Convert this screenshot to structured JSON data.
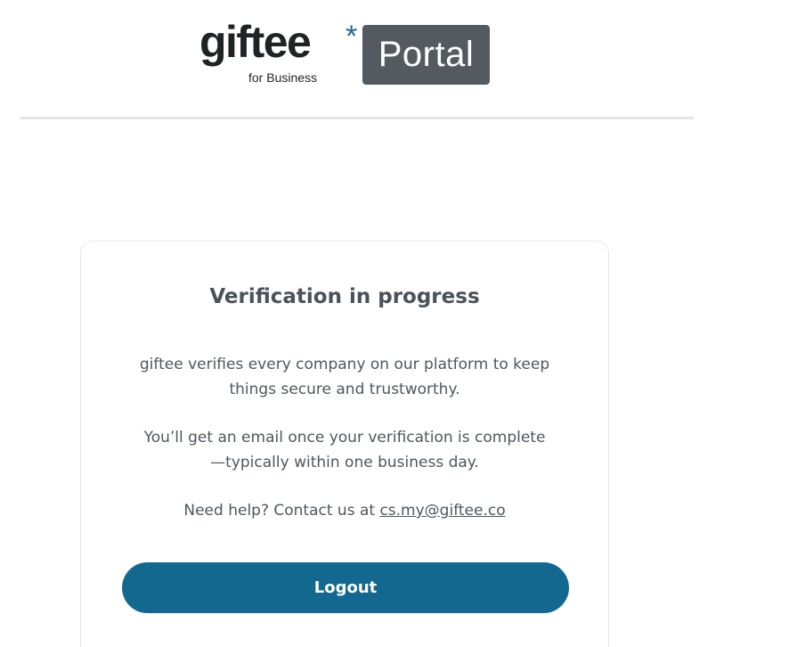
{
  "header": {
    "brand_name": "giftee",
    "brand_mark": "*",
    "brand_sub": "for Business",
    "portal_label": "Portal"
  },
  "card": {
    "title": "Verification in progress",
    "para1_line1": "giftee verifies every company on our platform to keep",
    "para1_line2": "things secure and trustworthy.",
    "para2_line1": "You’ll get an email once your verification is complete",
    "para2_line2": "—typically within one business day.",
    "help_prefix": "Need help? Contact us at ",
    "contact_email": "cs.my@giftee.co",
    "logout_label": "Logout"
  },
  "colors": {
    "accent": "#136890",
    "brand_star": "#1a6a90",
    "portal_badge": "#535b61",
    "text": "#4f575e",
    "divider": "#e3e5e7"
  }
}
